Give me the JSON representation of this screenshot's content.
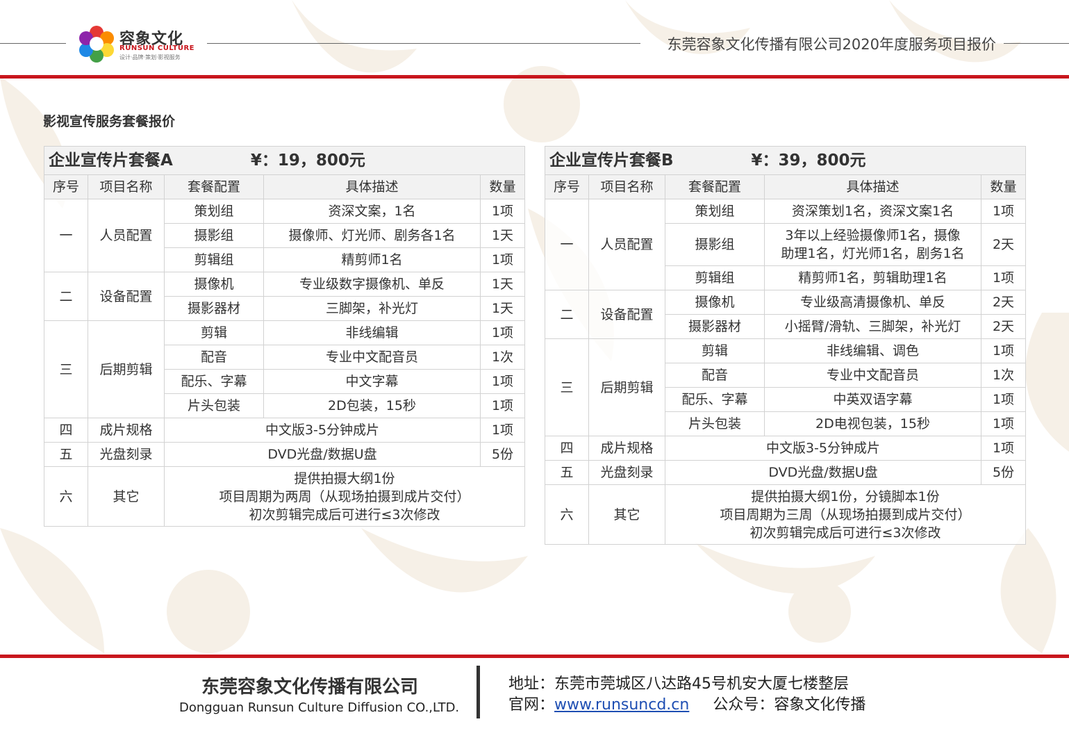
{
  "header": {
    "logo_cn": "容象文化",
    "logo_en": "RUNSUN CULTURE",
    "logo_tagline": "设计·品牌·策划·影视服务",
    "doc_title": "东莞容象文化传播有限公司2020年度服务项目报价"
  },
  "section_title": "影视宣传服务套餐报价",
  "columns": {
    "seq": "序号",
    "item": "项目名称",
    "config": "套餐配置",
    "desc": "具体描述",
    "qty": "数量"
  },
  "package_a": {
    "name": "企业宣传片套餐A",
    "price": "¥：19，800元",
    "groups": [
      {
        "seq": "一",
        "item": "人员配置",
        "rows": [
          {
            "config": "策划组",
            "desc": "资深文案，1名",
            "qty": "1项"
          },
          {
            "config": "摄影组",
            "desc": "摄像师、灯光师、剧务各1名",
            "qty": "1天"
          },
          {
            "config": "剪辑组",
            "desc": "精剪师1名",
            "qty": "1项"
          }
        ]
      },
      {
        "seq": "二",
        "item": "设备配置",
        "rows": [
          {
            "config": "摄像机",
            "desc": "专业级数字摄像机、单反",
            "qty": "1天"
          },
          {
            "config": "摄影器材",
            "desc": "三脚架，补光灯",
            "qty": "1天"
          }
        ]
      },
      {
        "seq": "三",
        "item": "后期剪辑",
        "rows": [
          {
            "config": "剪辑",
            "desc": "非线编辑",
            "qty": "1项"
          },
          {
            "config": "配音",
            "desc": "专业中文配音员",
            "qty": "1次"
          },
          {
            "config": "配乐、字幕",
            "desc": "中文字幕",
            "qty": "1项"
          },
          {
            "config": "片头包装",
            "desc": "2D包装，15秒",
            "qty": "1项"
          }
        ]
      }
    ],
    "spec": {
      "seq": "四",
      "item": "成片规格",
      "desc": "中文版3-5分钟成片",
      "qty": "1项"
    },
    "disc": {
      "seq": "五",
      "item": "光盘刻录",
      "desc": "DVD光盘/数据U盘",
      "qty": "5份"
    },
    "other": {
      "seq": "六",
      "item": "其它",
      "lines": [
        "提供拍摄大纲1份",
        "项目周期为两周（从现场拍摄到成片交付）",
        "初次剪辑完成后可进行≤3次修改"
      ]
    }
  },
  "package_b": {
    "name": "企业宣传片套餐B",
    "price": "¥：39，800元",
    "groups": [
      {
        "seq": "一",
        "item": "人员配置",
        "rows": [
          {
            "config": "策划组",
            "desc": "资深策划1名，资深文案1名",
            "qty": "1项"
          },
          {
            "config": "摄影组",
            "desc_lines": [
              "3年以上经验摄像师1名，摄像",
              "助理1名，灯光师1名，剧务1名"
            ],
            "qty": "2天"
          },
          {
            "config": "剪辑组",
            "desc": "精剪师1名，剪辑助理1名",
            "qty": "1项"
          }
        ]
      },
      {
        "seq": "二",
        "item": "设备配置",
        "rows": [
          {
            "config": "摄像机",
            "desc": "专业级高清摄像机、单反",
            "qty": "2天"
          },
          {
            "config": "摄影器材",
            "desc": "小摇臂/滑轨、三脚架，补光灯",
            "qty": "2天"
          }
        ]
      },
      {
        "seq": "三",
        "item": "后期剪辑",
        "rows": [
          {
            "config": "剪辑",
            "desc": "非线编辑、调色",
            "qty": "1项"
          },
          {
            "config": "配音",
            "desc": "专业中文配音员",
            "qty": "1次"
          },
          {
            "config": "配乐、字幕",
            "desc": "中英双语字幕",
            "qty": "1项"
          },
          {
            "config": "片头包装",
            "desc": "2D电视包装，15秒",
            "qty": "1项"
          }
        ]
      }
    ],
    "spec": {
      "seq": "四",
      "item": "成片规格",
      "desc": "中文版3-5分钟成片",
      "qty": "1项"
    },
    "disc": {
      "seq": "五",
      "item": "光盘刻录",
      "desc": "DVD光盘/数据U盘",
      "qty": "5份"
    },
    "other": {
      "seq": "六",
      "item": "其它",
      "lines": [
        "提供拍摄大纲1份，分镜脚本1份",
        "项目周期为三周（从现场拍摄到成片交付）",
        "初次剪辑完成后可进行≤3次修改"
      ]
    }
  },
  "footer": {
    "company_cn": "东莞容象文化传播有限公司",
    "company_en": "Dongguan Runsun Culture Diffusion CO.,LTD.",
    "address_label": "地址：",
    "address": "东莞市莞城区八达路45号机安大厦七楼整层",
    "website_label": "官网：",
    "website": "www.runsuncd.cn",
    "wechat_label": "公众号：",
    "wechat": "容象文化传播"
  },
  "colors": {
    "accent_red": "#c8161d",
    "link_blue": "#1f4fb3",
    "watermark": "#f5efe6"
  }
}
